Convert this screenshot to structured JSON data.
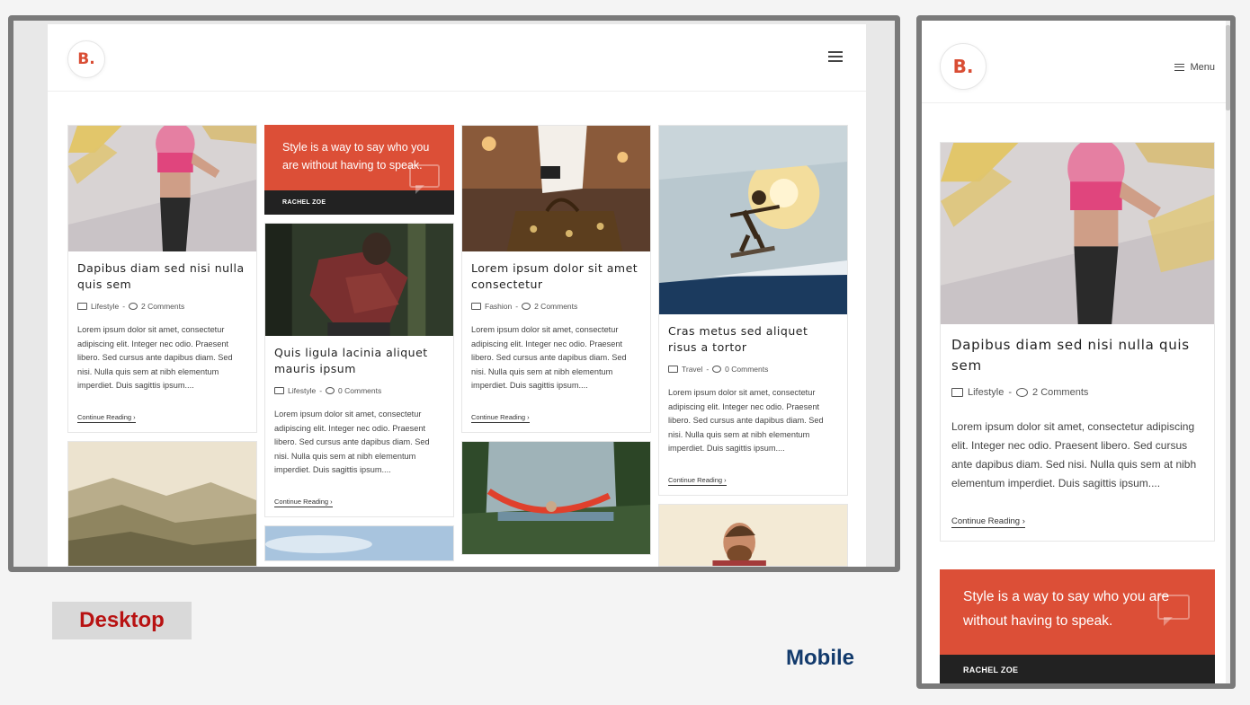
{
  "brand": {
    "logo": "B."
  },
  "desktop": {
    "label": "Desktop",
    "posts": {
      "p1": {
        "title": "Dapibus diam sed nisi nulla quis sem",
        "category": "Lifestyle",
        "comments": "2 Comments"
      },
      "p2": {
        "title": "Quis ligula lacinia aliquet mauris ipsum",
        "category": "Lifestyle",
        "comments": "0 Comments"
      },
      "p3": {
        "title": "Lorem ipsum dolor sit amet consectetur",
        "category": "Fashion",
        "comments": "2 Comments"
      },
      "p4": {
        "title": "Cras metus sed aliquet risus a tortor",
        "category": "Travel",
        "comments": "0 Comments"
      }
    },
    "quote": {
      "text": "Style is a way to say who you are without having to speak.",
      "author": "RACHEL ZOE"
    }
  },
  "mobile": {
    "label": "Mobile",
    "menu_label": "Menu",
    "post": {
      "title": "Dapibus diam sed nisi nulla quis sem",
      "category": "Lifestyle",
      "comments": "2 Comments"
    },
    "quote": {
      "text": "Style is a way to say who you are without having to speak.",
      "author": "RACHEL ZOE"
    }
  },
  "common": {
    "excerpt": "Lorem ipsum dolor sit amet, consectetur adipiscing elit. Integer nec odio. Praesent libero. Sed cursus ante dapibus diam. Sed nisi. Nulla quis sem at nibh elementum imperdiet. Duis sagittis ipsum....",
    "continue_label": "Continue Reading ›",
    "meta_sep": "-"
  },
  "colors": {
    "accent": "#dc4f37",
    "dark": "#222222",
    "desktop_label": "#b81212",
    "mobile_label": "#123a6c"
  },
  "icons": [
    "hamburger-icon",
    "folder-icon",
    "comment-icon",
    "quote-bubble-icon"
  ]
}
